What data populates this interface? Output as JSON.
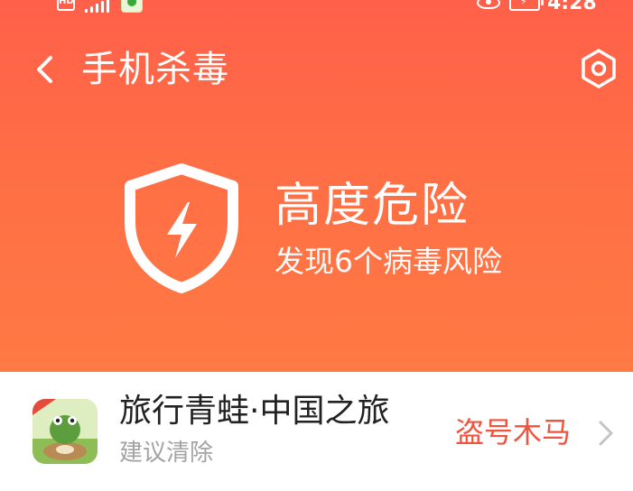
{
  "status_bar": {
    "hd_label": "HD",
    "time": "4:28"
  },
  "header": {
    "title": "手机杀毒",
    "back_icon": "back-arrow-icon",
    "settings_icon": "settings-hexagon-icon"
  },
  "summary": {
    "level": "高度危险",
    "detail": "发现6个病毒风险",
    "shield_icon": "shield-bolt-icon"
  },
  "threat_list": [
    {
      "app_name": "旅行青蛙·中国之旅",
      "advice": "建议清除",
      "threat_type": "盗号木马",
      "icon": "travel-frog-app-icon"
    }
  ],
  "colors": {
    "hero_top": "#ff6049",
    "hero_bottom": "#ff7a44",
    "threat_text": "#f2533e",
    "advice_text": "#a3a3a3"
  }
}
